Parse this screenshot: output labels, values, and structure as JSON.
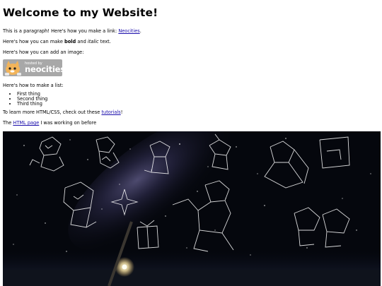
{
  "heading": "Welcome to my Website!",
  "para_link": {
    "before": "This is a paragraph! Here's how you make a link: ",
    "link": "Neocities",
    "after": "."
  },
  "para_format": {
    "before": "Here's how you can make ",
    "bold": "bold",
    "middle": " and ",
    "italic": "italic",
    "after": " text."
  },
  "para_image": "Here's how you can add an image:",
  "badge": {
    "small": "hosted by",
    "big": "neocities"
  },
  "para_list": "Here's how to make a list:",
  "list_items": [
    "First thing",
    "Second thing",
    "Third thing"
  ],
  "para_learn": {
    "before": "To learn more HTML/CSS, check out these ",
    "link": "tutorials",
    "after": "!"
  },
  "para_page": {
    "before": "The ",
    "link": "HTML page",
    "after": " I was working on before"
  },
  "colors": {
    "link": "#1a0dab",
    "badge_bg": "#a8a8a8",
    "sky": "#05070d"
  }
}
